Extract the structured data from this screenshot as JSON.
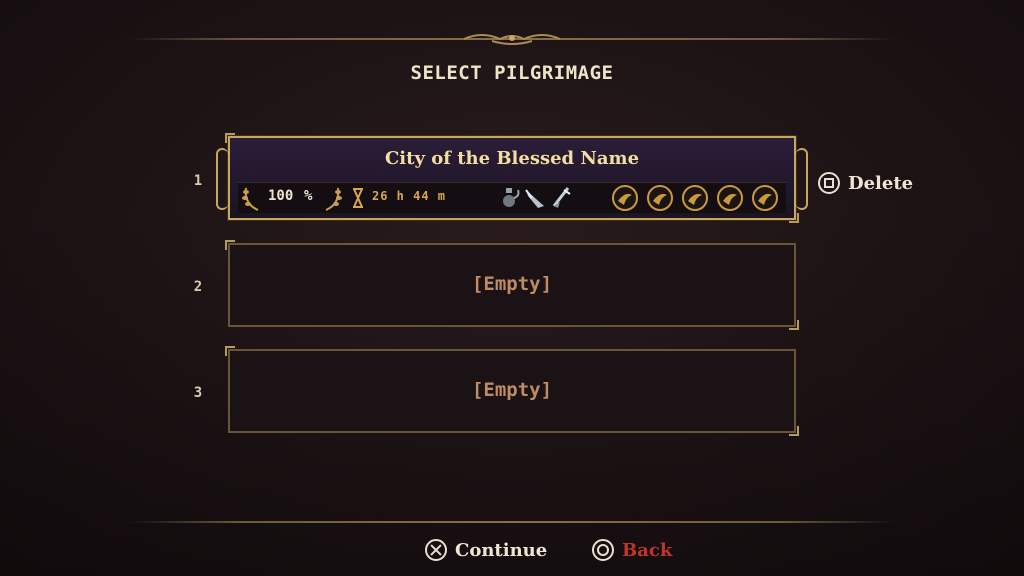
{
  "screen": {
    "title": "SELECT PILGRIMAGE"
  },
  "slots": [
    {
      "number": "1",
      "state": "saved",
      "name": "City of the Blessed Name",
      "completion": "100",
      "completion_unit": "%",
      "playtime": "26 h 44 m",
      "items": [
        "bile-flask-icon",
        "prayer-icon",
        "relic-icon"
      ],
      "medals": [
        "cherub-medal-icon",
        "cherub-medal-icon",
        "cherub-medal-icon",
        "cherub-medal-icon",
        "cherub-medal-icon"
      ]
    },
    {
      "number": "2",
      "state": "empty",
      "label": "[Empty]"
    },
    {
      "number": "3",
      "state": "empty",
      "label": "[Empty]"
    }
  ],
  "prompts": {
    "delete": {
      "glyph": "square-button-icon",
      "label": "Delete"
    },
    "continue": {
      "glyph": "cross-button-icon",
      "label": "Continue"
    },
    "back": {
      "glyph": "circle-button-icon",
      "label": "Back",
      "color": "#c0352b"
    }
  },
  "colors": {
    "gold": "#c8a85c",
    "empty_text": "#c08a62",
    "playtime": "#d9a64c"
  }
}
